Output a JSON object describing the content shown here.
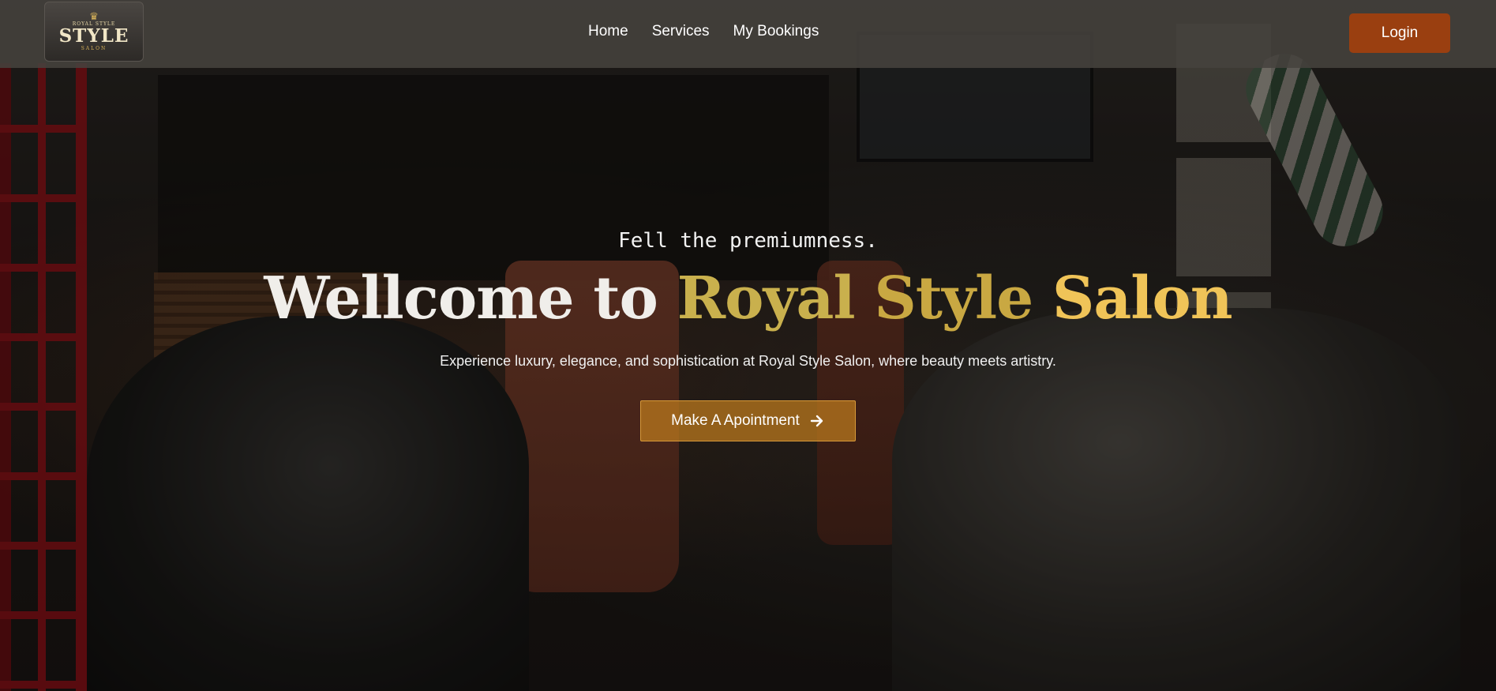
{
  "logo": {
    "small_text": "ROYAL STYLE",
    "main_text": "STYLE",
    "sub_text": "SALON"
  },
  "nav": {
    "links": [
      "Home",
      "Services",
      "My Bookings"
    ],
    "login_label": "Login"
  },
  "hero": {
    "tagline": "Fell the premiumness.",
    "headline_prefix": "Wellcome to",
    "headline_royal": "Royal",
    "headline_style": "Style",
    "headline_salon": "Salon",
    "description": "Experience luxury, elegance, and sophistication at Royal Style Salon, where beauty meets artistry.",
    "cta_label": "Make A Apointment",
    "cta_icon": "arrow-right-icon"
  },
  "colors": {
    "login_bg": "#9a3f10",
    "cta_bg": "#b9781e",
    "gold": "#c9b04d",
    "salon_gold": "#f0c458"
  }
}
